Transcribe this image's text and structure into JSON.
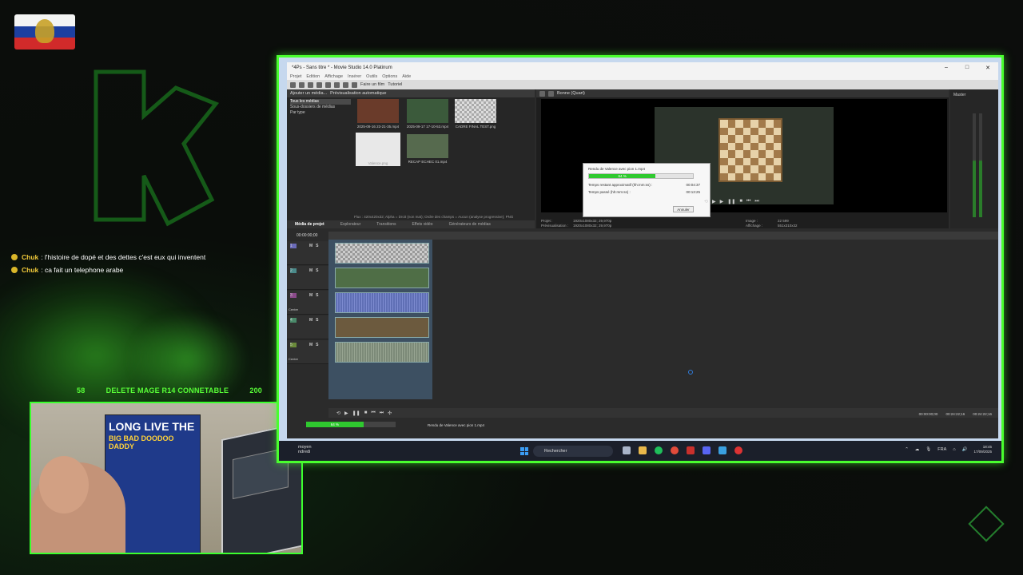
{
  "overlay": {
    "chat": [
      {
        "user": "Chuk",
        "message": ": l'histoire de dopé et des dettes c'est eux qui inventent"
      },
      {
        "user": "Chuk",
        "message": ": ca fait un telephone arabe"
      }
    ],
    "goal": {
      "left": "58",
      "label": "DELETE MAGE R14 CONNETABLE",
      "right": "200"
    },
    "poster_title": "LONG LIVE THE",
    "poster_subtitle": "BIG BAD DOODOO DADDY",
    "accent_color": "#49ff2e"
  },
  "app": {
    "title": "*4Ps - Sans titre * - Movie Studio 14.0 Platinum",
    "menu": [
      "Projet",
      "Edition",
      "Affichage",
      "Insérer",
      "Outils",
      "Options",
      "Aide"
    ],
    "toolbar": {
      "make_movie": "Faire un film",
      "tutorial": "Tutoriel"
    },
    "media": {
      "toolbar_label": "Ajouter un média...",
      "preview_label": "Prévisualisation automatique",
      "tree": [
        "Tous les médias",
        "Sous-dossiers de médias",
        "Par type"
      ],
      "thumbs": [
        {
          "caption": "2025-09-16 23-21-35.mp4"
        },
        {
          "caption": "2025-09-17 17-10-53.mp4"
        },
        {
          "caption": "CADRE FINAL TEST.png"
        },
        {
          "caption": "Valence.png"
        },
        {
          "caption": "RECAP ECHEC 01.mp4"
        }
      ],
      "status": "Flux : 420x420x32; Alpha = Droit (non mat); Ordre des champs = Aucun (analyse progressive); PNG",
      "tabs": [
        "Média de projet",
        "Explorateur",
        "Transitions",
        "Effets vidéo",
        "Générateurs de médias"
      ]
    },
    "preview": {
      "quality": "Bonne (Quart)",
      "project_label": "Projet :",
      "project_value": "1920x1080x32; 29,970p",
      "prev_label": "Prévisualisation :",
      "prev_value": "1920x1080x32; 29,970p",
      "image_label": "Image :",
      "image_value": "22 599",
      "display_label": "Affichage :",
      "display_value": "551x310x32"
    },
    "render_dialog": {
      "title": "Rendu de Valence avec pion 1.mp4",
      "progress_text": "64 %",
      "progress": 0.64,
      "remaining_label": "Temps restant approximatif (hh:mm:ss) :",
      "remaining_value": "00:04:37",
      "elapsed_label": "Temps passé (hh:mm:ss) :",
      "elapsed_value": "00:13:25",
      "cancel_label": "Annuler"
    },
    "mixer": {
      "title": "Master"
    },
    "timeline": {
      "timecode": "00:00:00;00",
      "tracks": [
        {
          "num": "1",
          "type": "video",
          "label": ""
        },
        {
          "num": "2",
          "type": "video",
          "label": ""
        },
        {
          "num": "3",
          "type": "audio",
          "label": "Centre"
        },
        {
          "num": "4",
          "type": "video",
          "label": ""
        },
        {
          "num": "5",
          "type": "audio",
          "label": "Centre"
        }
      ],
      "time_start": "00:00:00;00",
      "time_end": "00:24:22;16",
      "time_len": "00:24:22;16",
      "render_progress_text": "64 %",
      "render_label": "Rendu de Valence avec pion 1.mp4"
    },
    "taskbar": {
      "weather_line1": "moyen",
      "weather_line2": "ndredi",
      "search_placeholder": "Rechercher",
      "lang": "FRA",
      "time": "18:45",
      "date": "17/09/2025"
    }
  }
}
